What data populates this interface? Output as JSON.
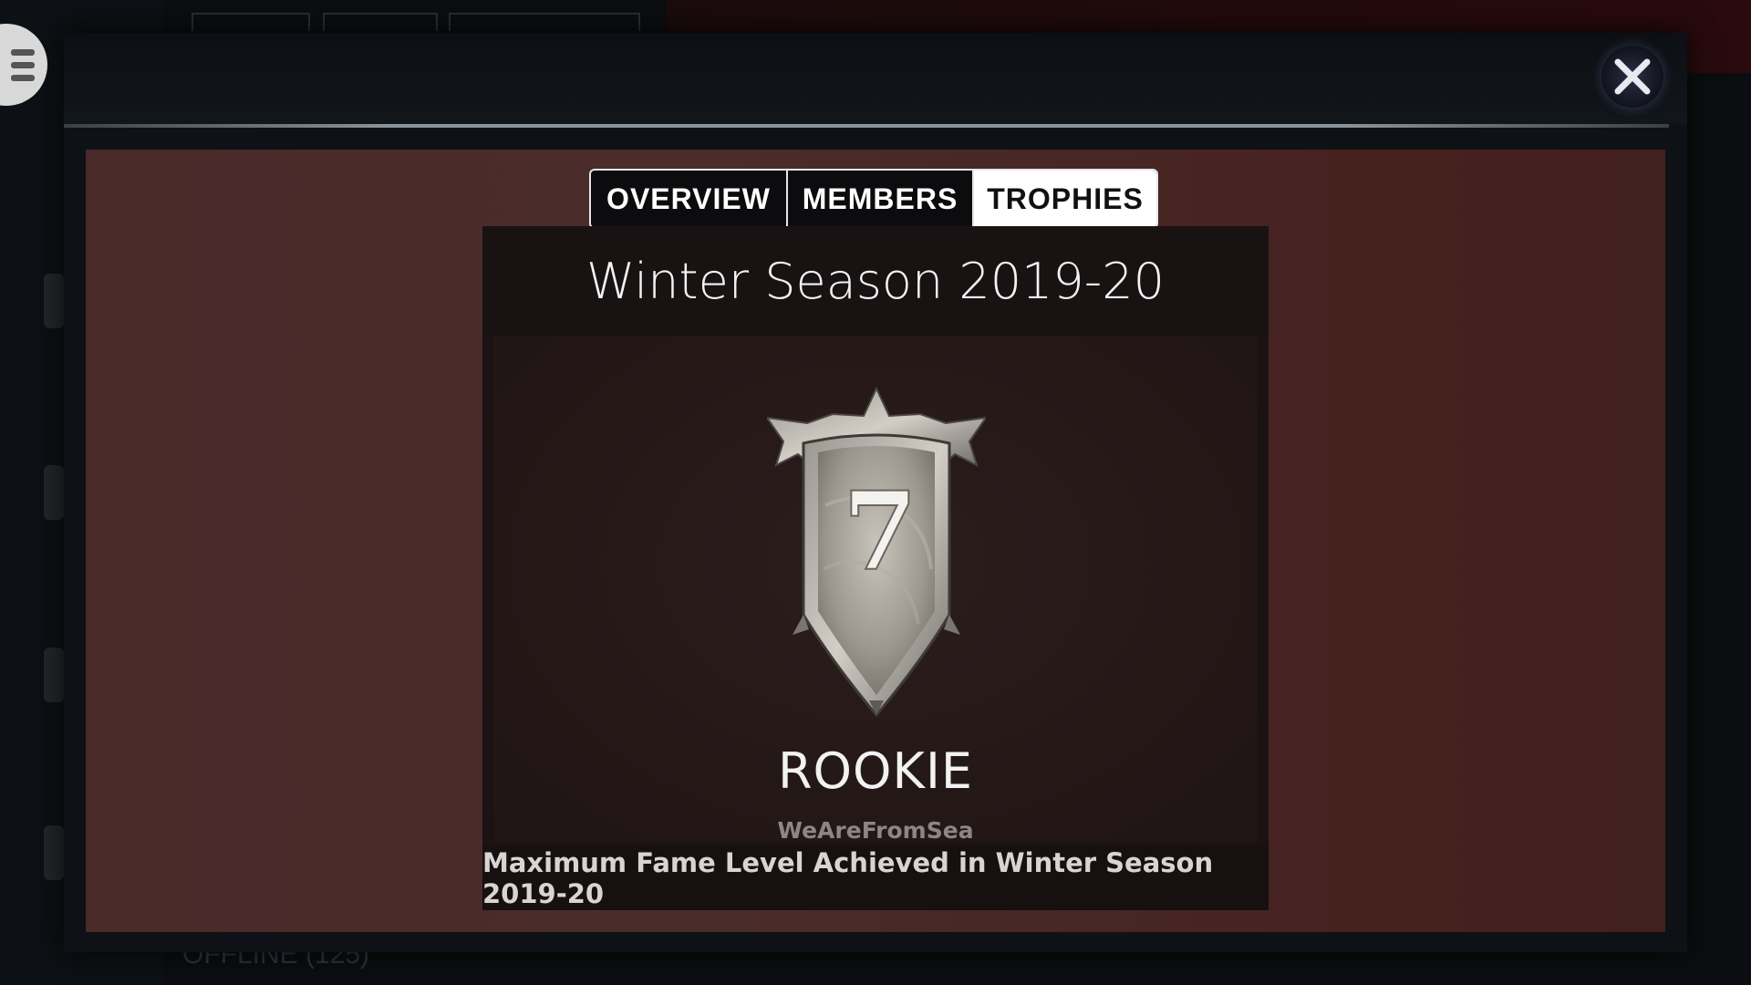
{
  "tabs": [
    {
      "label": "OVERVIEW",
      "active": false
    },
    {
      "label": "MEMBERS",
      "active": false
    },
    {
      "label": "TROPHIES",
      "active": true
    }
  ],
  "trophy": {
    "season_title": "Winter Season 2019-20",
    "level_number": "7",
    "rank": "ROOKIE",
    "holder": "WeAreFromSea",
    "description": "Maximum Fame Level Achieved in Winter Season 2019-20"
  },
  "background": {
    "offline_label": "OFFLINE (125)"
  },
  "icons": {
    "menu": "hamburger-menu-icon",
    "close": "close-icon",
    "trophy": "shield-trophy-icon"
  },
  "colors": {
    "modal_background": "#4a2a29",
    "card_background": "#1a1213",
    "active_tab": "#ffffff",
    "inactive_tab": "#0c0c0e"
  }
}
